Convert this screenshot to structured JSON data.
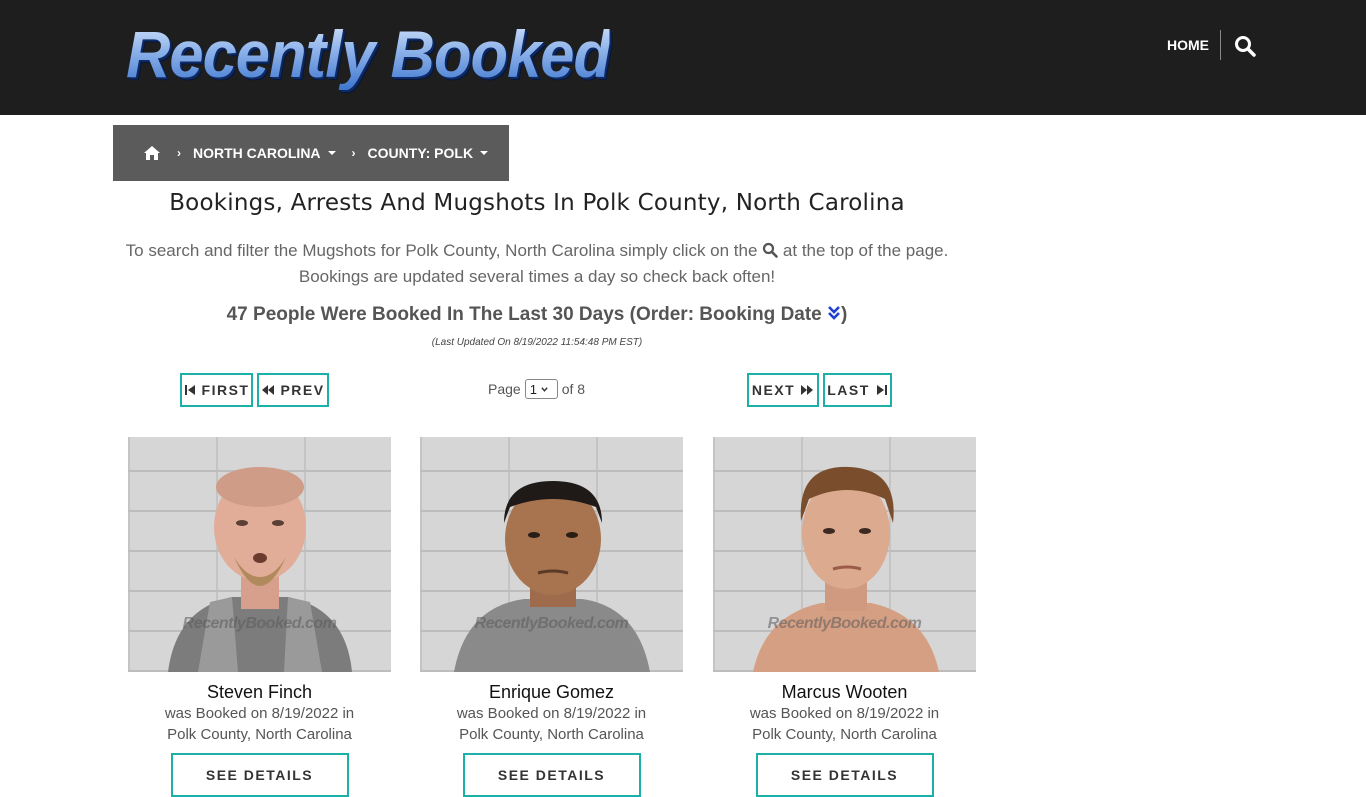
{
  "header": {
    "logo_text": "Recently Booked",
    "nav_home": "HOME"
  },
  "breadcrumb": {
    "state": "NORTH CAROLINA",
    "county": "COUNTY: POLK"
  },
  "main": {
    "title": "Bookings, Arrests And Mugshots In Polk County, North Carolina",
    "intro_before": "To search and filter the Mugshots for Polk County, North Carolina simply click on the",
    "intro_after": "at the top of the page.",
    "intro_line2": "Bookings are updated several times a day so check back often!",
    "count_text": "47 People Were Booked In The Last 30 Days (Order: Booking Date",
    "count_close": ")",
    "last_updated": "(Last Updated On 8/19/2022 11:54:48 PM EST)"
  },
  "pager": {
    "first": "FIRST",
    "prev": "PREV",
    "next": "NEXT",
    "last": "LAST",
    "page_label": "Page",
    "current_page": "1",
    "of_label": "of 8"
  },
  "bookings": [
    {
      "name": "Steven Finch",
      "line1": "was Booked on 8/19/2022 in",
      "line2": "Polk County, North Carolina",
      "button": "SEE DETAILS"
    },
    {
      "name": "Enrique Gomez",
      "line1": "was Booked on 8/19/2022 in",
      "line2": "Polk County, North Carolina",
      "button": "SEE DETAILS"
    },
    {
      "name": "Marcus Wooten",
      "line1": "was Booked on 8/19/2022 in",
      "line2": "Polk County, North Carolina",
      "button": "SEE DETAILS"
    }
  ],
  "watermark": "RecentlyBooked.com",
  "colors": {
    "header_bg": "#1e1e1e",
    "breadcrumb_bg": "#5b5b5b",
    "accent_teal": "#1cb0a8",
    "logo_blue": "#8fb5ea",
    "sort_icon": "#1f3fd6"
  },
  "icons": {
    "search": "search-icon",
    "home": "home-icon",
    "sort": "double-chevron-down-icon"
  }
}
